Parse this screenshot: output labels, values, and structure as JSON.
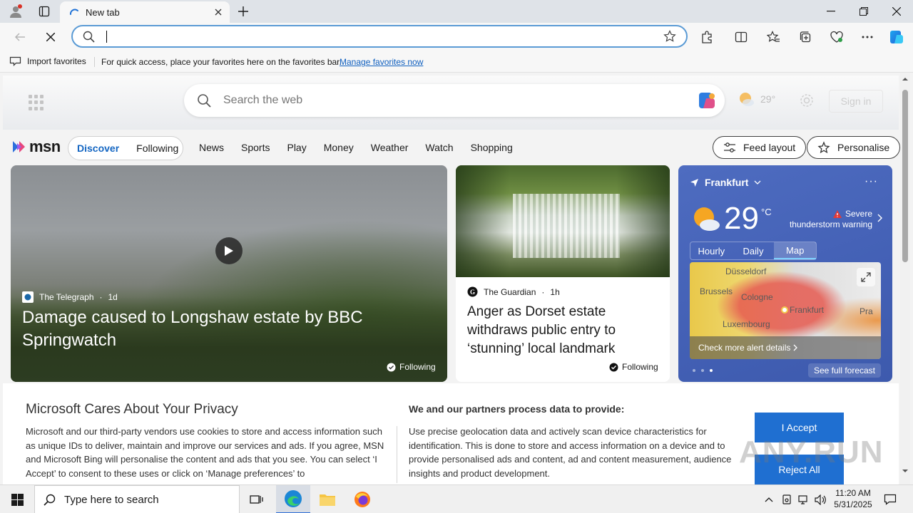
{
  "browser": {
    "tab": {
      "title": "New tab"
    },
    "address": {
      "value": ""
    },
    "favorites_bar": {
      "import_label": "Import favorites",
      "hint": "For quick access, place your favorites here on the favorites bar.",
      "manage_link": "Manage favorites now"
    }
  },
  "page": {
    "search": {
      "placeholder": "Search the web"
    },
    "header_weather": {
      "temp": "29°"
    },
    "sign_in": "Sign in",
    "logo": "msn",
    "feed_tabs": [
      "Discover",
      "Following"
    ],
    "nav": [
      "News",
      "Sports",
      "Play",
      "Money",
      "Weather",
      "Watch",
      "Shopping"
    ],
    "feed_layout": "Feed layout",
    "personalise": "Personalise",
    "hero": {
      "source": "The Telegraph",
      "age": "1d",
      "title": "Damage caused to Longshaw estate by BBC Springwatch",
      "following": "Following"
    },
    "card2": {
      "source": "The Guardian",
      "age": "1h",
      "title": "Anger as Dorset estate withdraws public entry to ‘stunning’ local landmark",
      "following": "Following"
    },
    "weather": {
      "location": "Frankfurt",
      "temp": "29",
      "unit": "°C",
      "alert_line1": "Severe",
      "alert_line2": "thunderstorm warning",
      "tabs": [
        "Hourly",
        "Daily",
        "Map"
      ],
      "active_tab": "Map",
      "map_cities": [
        "Düsseldorf",
        "Brussels",
        "Cologne",
        "Frankfurt",
        "Luxembourg",
        "Pra"
      ],
      "alert_link": "Check more alert details",
      "forecast_link": "See full forecast"
    },
    "privacy": {
      "title": "Microsoft Cares About Your Privacy",
      "body": "Microsoft and our third-party vendors use cookies to store and access information such as unique IDs to deliver, maintain and improve our services and ads. If you agree, MSN and Microsoft Bing will personalise the content and ads that you see. You can select ‘I Accept’ to consent to these uses or click on ‘Manage preferences’ to",
      "heading2": "We and our partners process data to provide:",
      "body2": "Use precise geolocation data and actively scan device characteristics for identification. This is done to store and access information on a device and to provide personalised ads and content, ad and content measurement, audience insights and product development.",
      "accept": "I Accept",
      "reject": "Reject All"
    },
    "watermark": "ANY.RUN"
  },
  "taskbar": {
    "search_placeholder": "Type here to search",
    "time": "11:20 AM",
    "date": "5/31/2025"
  },
  "colors": {
    "accent": "#1f6fd1",
    "weather_card": "#4360b5",
    "link": "#0f5fbf"
  }
}
